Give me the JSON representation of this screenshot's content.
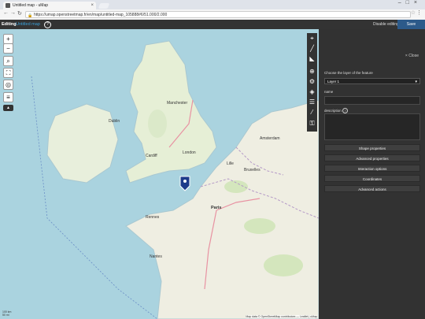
{
  "browser": {
    "tab_title": "Untitled map - uMap",
    "url": "https://umap.openstreetmap.fr/en/map/untitled-map_105888#6/51.000/2.000"
  },
  "toolbar": {
    "editing_label": "Editing",
    "map_name": "Untitled map",
    "disable_editing": "Disable editing",
    "save": "Save"
  },
  "panel": {
    "close": "Close",
    "layer_label": "Choose the layer of the feature",
    "layer_value": "Layer 1",
    "name_label": "name",
    "description_label": "description",
    "buttons": [
      "Shape properties",
      "Advanced properties",
      "Interaction options",
      "Coordinates",
      "Advanced actions"
    ]
  },
  "map": {
    "attribution": "Map data © OpenStreetMap contributors — Leaflet | uMap",
    "scale_top": "100 km",
    "scale_bottom": "50 mi",
    "places": [
      {
        "name": "Dublin"
      },
      {
        "name": "Manchester"
      },
      {
        "name": "London"
      },
      {
        "name": "Cardiff"
      },
      {
        "name": "Amsterdam"
      },
      {
        "name": "Bruxelles"
      },
      {
        "name": "Paris"
      },
      {
        "name": "Nantes"
      },
      {
        "name": "Lille"
      },
      {
        "name": "Rennes"
      }
    ]
  }
}
